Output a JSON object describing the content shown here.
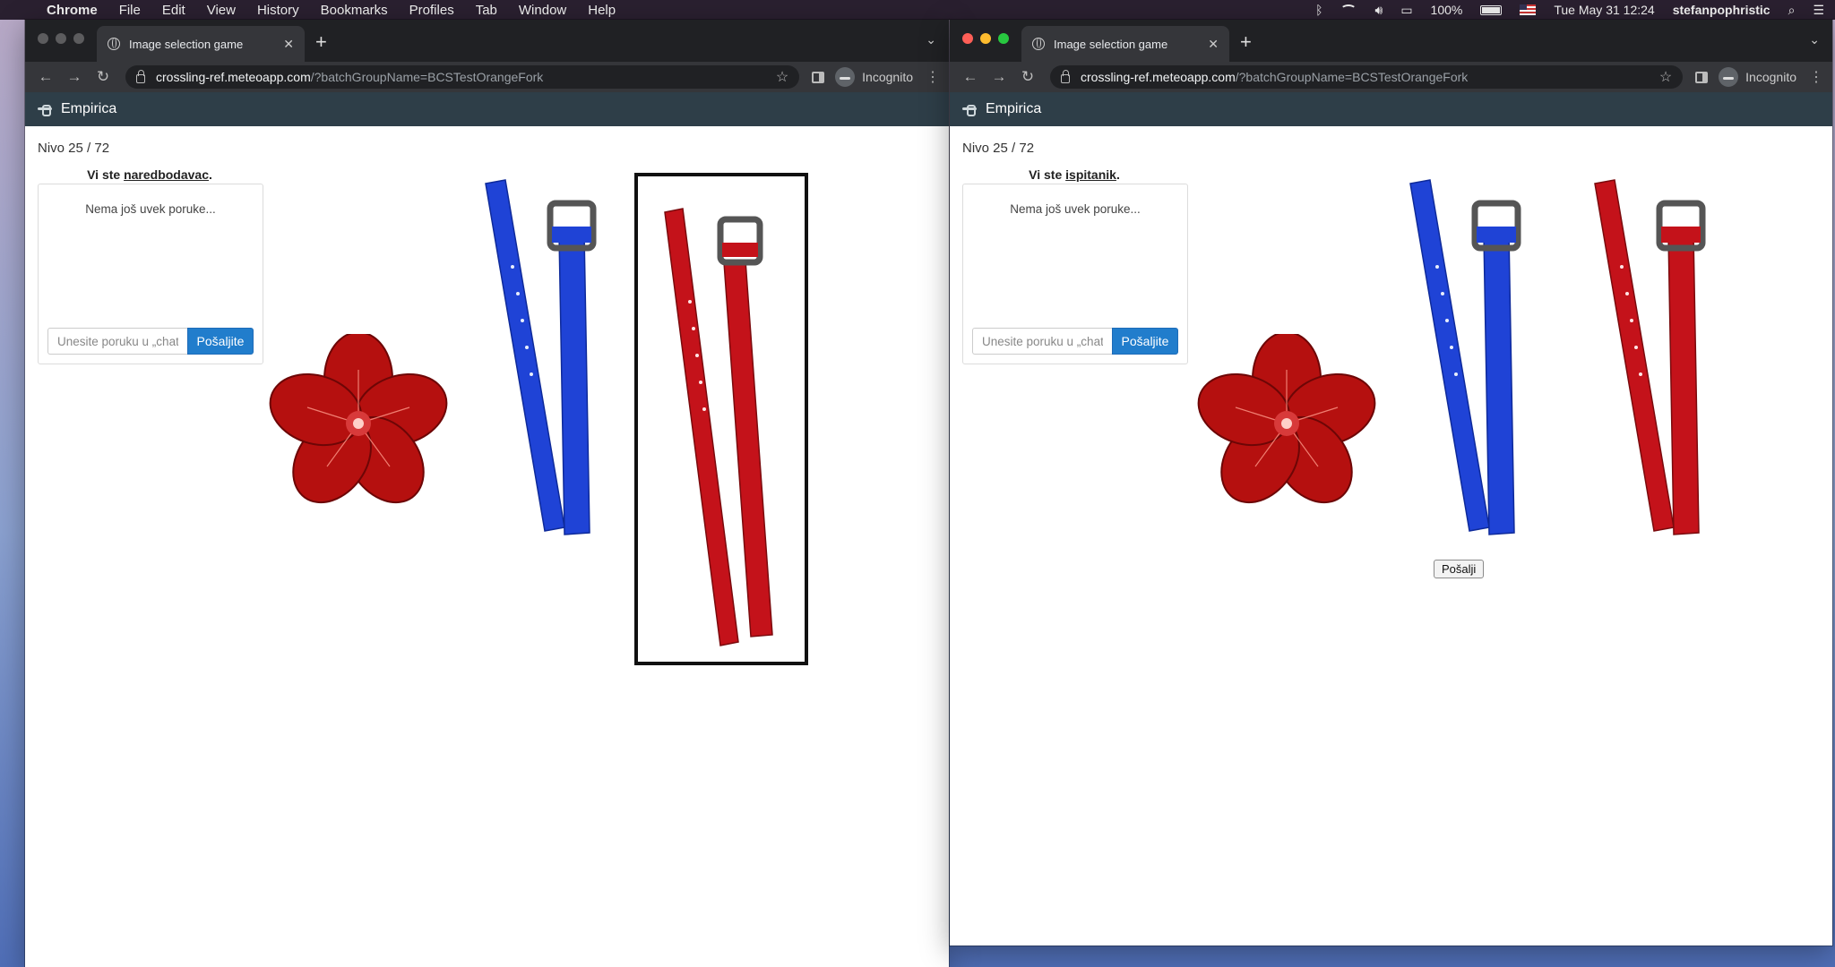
{
  "menubar": {
    "app": "Chrome",
    "items": [
      "File",
      "Edit",
      "View",
      "History",
      "Bookmarks",
      "Profiles",
      "Tab",
      "Window",
      "Help"
    ],
    "battery": "100%",
    "datetime": "Tue May 31  12:24",
    "user": "stefanpophristic"
  },
  "windows": [
    {
      "tab_title": "Image selection game",
      "url_host": "crossling-ref.meteoapp.com",
      "url_path": "/?batchGroupName=BCSTestOrangeFork",
      "incognito": "Incognito",
      "app_name": "Empirica",
      "level": "Nivo 25 / 72",
      "role_prefix": "Vi ste ",
      "role": "naredbodavac",
      "role_suffix": ".",
      "chat_empty": "Nema još uvek poruke...",
      "chat_placeholder": "Unesite poruku u „chat\"",
      "chat_send": "Pošaljite",
      "cards": [
        "flower-red",
        "belt-blue",
        "belt-red"
      ],
      "selected_card": "belt-red"
    },
    {
      "tab_title": "Image selection game",
      "url_host": "crossling-ref.meteoapp.com",
      "url_path": "/?batchGroupName=BCSTestOrangeFork",
      "incognito": "Incognito",
      "app_name": "Empirica",
      "level": "Nivo 25 / 72",
      "role_prefix": "Vi ste ",
      "role": "ispitanik",
      "role_suffix": ".",
      "chat_empty": "Nema još uvek poruke...",
      "chat_placeholder": "Unesite poruku u „chat\"",
      "chat_send": "Pošaljite",
      "cards": [
        "flower-red",
        "belt-blue",
        "belt-red"
      ],
      "submit_label": "Pošalji"
    }
  ],
  "colors": {
    "belt_blue": "#1f43d6",
    "belt_red": "#c4121a",
    "flower_red": "#b5100f",
    "app_bar": "#2e3e48",
    "send_button": "#217dcc"
  }
}
